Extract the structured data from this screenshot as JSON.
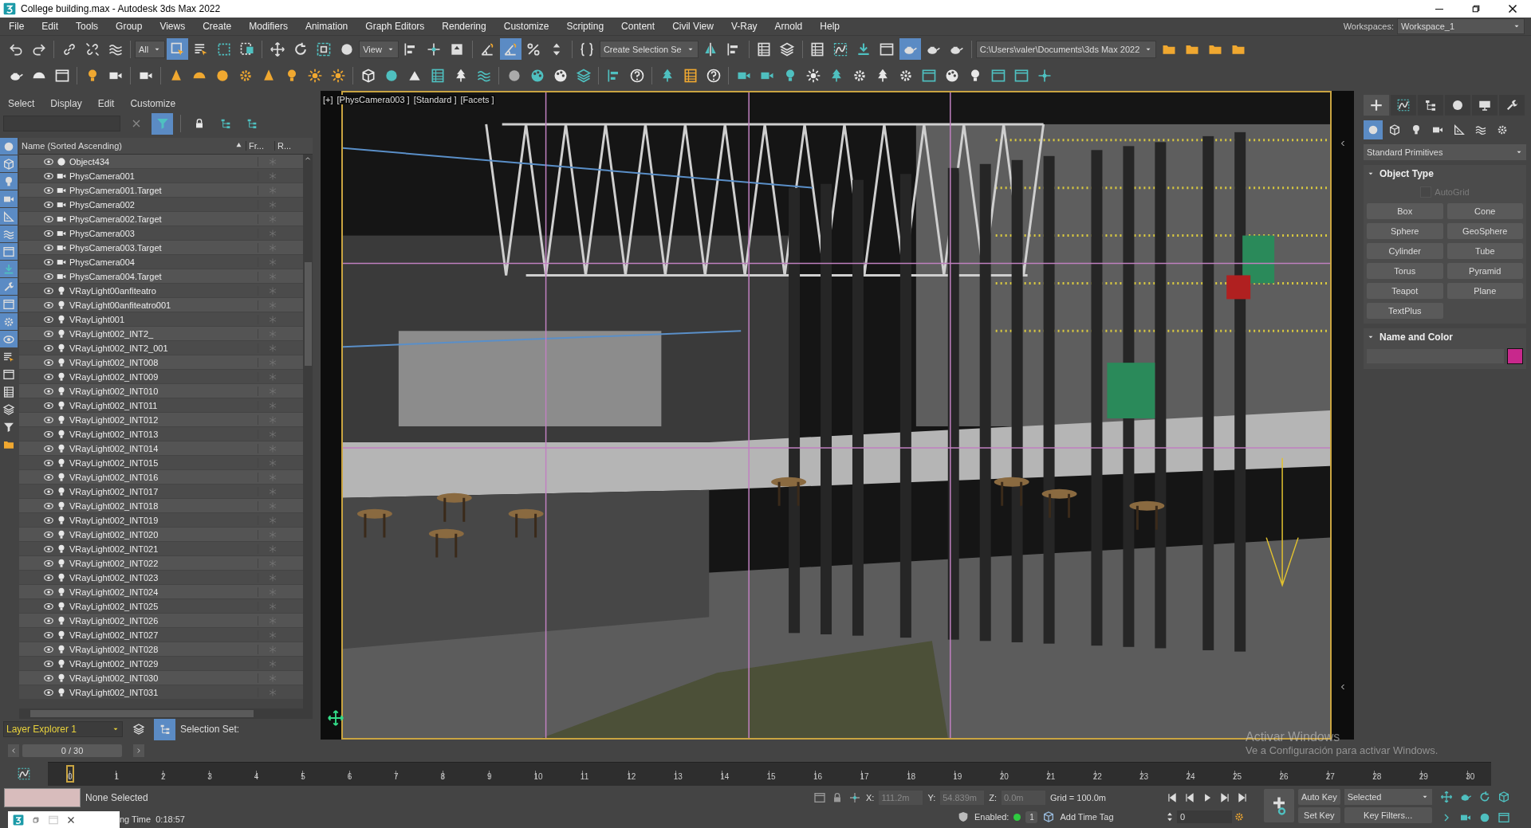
{
  "window": {
    "title": "College building.max - Autodesk 3ds Max 2022"
  },
  "menu_bar": {
    "items": [
      "File",
      "Edit",
      "Tools",
      "Group",
      "Views",
      "Create",
      "Modifiers",
      "Animation",
      "Graph Editors",
      "Rendering",
      "Customize",
      "Scripting",
      "Content",
      "Civil View",
      "V-Ray",
      "Arnold",
      "Help"
    ],
    "workspace_label": "Workspaces:",
    "workspace": "Workspace_1"
  },
  "toolbar_1": [
    {
      "kind": "button",
      "pressed": false
    },
    {
      "kind": "button",
      "pressed": false
    },
    {
      "kind": "sep"
    },
    {
      "kind": "button",
      "pressed": false
    },
    {
      "kind": "button",
      "pressed": false
    },
    {
      "kind": "button",
      "pressed": false
    },
    {
      "kind": "sep"
    },
    {
      "kind": "dropdown",
      "value": "All"
    },
    {
      "kind": "button",
      "pressed": true
    },
    {
      "kind": "button",
      "pressed": false
    },
    {
      "kind": "button",
      "pressed": false
    },
    {
      "kind": "button",
      "pressed": false
    },
    {
      "kind": "sep"
    },
    {
      "kind": "button",
      "pressed": false
    },
    {
      "kind": "button",
      "pressed": false
    },
    {
      "kind": "button",
      "pressed": false
    },
    {
      "kind": "button",
      "pressed": false
    },
    {
      "kind": "dropdown",
      "value": "View"
    },
    {
      "kind": "button",
      "pressed": false
    },
    {
      "kind": "button",
      "pressed": false
    },
    {
      "kind": "button",
      "pressed": false
    },
    {
      "kind": "sep"
    },
    {
      "kind": "button",
      "pressed": false
    },
    {
      "kind": "button",
      "pressed": true
    },
    {
      "kind": "button",
      "pressed": false
    },
    {
      "kind": "button",
      "pressed": false
    },
    {
      "kind": "sep"
    },
    {
      "kind": "button",
      "pressed": false
    },
    {
      "kind": "dropdown",
      "value": "Create Selection Se"
    },
    {
      "kind": "button",
      "pressed": false
    },
    {
      "kind": "button",
      "pressed": false
    },
    {
      "kind": "sep"
    },
    {
      "kind": "button",
      "pressed": false
    },
    {
      "kind": "button",
      "pressed": false
    },
    {
      "kind": "sep"
    },
    {
      "kind": "button",
      "pressed": false
    },
    {
      "kind": "button",
      "pressed": false
    },
    {
      "kind": "button",
      "pressed": false
    },
    {
      "kind": "button",
      "pressed": false
    },
    {
      "kind": "button",
      "pressed": true
    },
    {
      "kind": "button",
      "pressed": false
    },
    {
      "kind": "button",
      "pressed": false
    },
    {
      "kind": "sep"
    },
    {
      "kind": "dropdown",
      "value": "C:\\Users\\valer\\Documents\\3ds Max 2022"
    },
    {
      "kind": "button",
      "pressed": false
    },
    {
      "kind": "button",
      "pressed": false
    },
    {
      "kind": "button",
      "pressed": false
    },
    {
      "kind": "button",
      "pressed": false
    }
  ],
  "toolbar_2": [
    {
      "kind": "button",
      "pressed": false
    },
    {
      "kind": "button",
      "pressed": false
    },
    {
      "kind": "button",
      "pressed": false
    },
    {
      "kind": "sep"
    },
    {
      "kind": "button",
      "pressed": false
    },
    {
      "kind": "button",
      "pressed": false
    },
    {
      "kind": "sep"
    },
    {
      "kind": "button",
      "pressed": false
    },
    {
      "kind": "sep"
    },
    {
      "kind": "button",
      "pressed": false
    },
    {
      "kind": "button",
      "pressed": false
    },
    {
      "kind": "button",
      "pressed": false
    },
    {
      "kind": "button",
      "pressed": false
    },
    {
      "kind": "button",
      "pressed": false
    },
    {
      "kind": "button",
      "pressed": false
    },
    {
      "kind": "button",
      "pressed": false
    },
    {
      "kind": "button",
      "pressed": false
    },
    {
      "kind": "sep"
    },
    {
      "kind": "button",
      "pressed": false
    },
    {
      "kind": "button",
      "pressed": false
    },
    {
      "kind": "button",
      "pressed": false
    },
    {
      "kind": "button",
      "pressed": false
    },
    {
      "kind": "button",
      "pressed": false
    },
    {
      "kind": "button",
      "pressed": false
    },
    {
      "kind": "sep"
    },
    {
      "kind": "button",
      "pressed": false
    },
    {
      "kind": "button",
      "pressed": false
    },
    {
      "kind": "button",
      "pressed": false
    },
    {
      "kind": "button",
      "pressed": false
    },
    {
      "kind": "sep"
    },
    {
      "kind": "button",
      "pressed": false
    },
    {
      "kind": "button",
      "pressed": false
    },
    {
      "kind": "sep"
    },
    {
      "kind": "button",
      "pressed": false
    },
    {
      "kind": "button",
      "pressed": false
    },
    {
      "kind": "button",
      "pressed": false
    },
    {
      "kind": "sep"
    },
    {
      "kind": "button",
      "pressed": false
    },
    {
      "kind": "button",
      "pressed": false
    },
    {
      "kind": "button",
      "pressed": false
    },
    {
      "kind": "button",
      "pressed": false
    },
    {
      "kind": "button",
      "pressed": false
    },
    {
      "kind": "button",
      "pressed": false
    },
    {
      "kind": "button",
      "pressed": false
    },
    {
      "kind": "button",
      "pressed": false
    },
    {
      "kind": "button",
      "pressed": false
    },
    {
      "kind": "button",
      "pressed": false
    },
    {
      "kind": "button",
      "pressed": false
    },
    {
      "kind": "button",
      "pressed": false
    },
    {
      "kind": "button",
      "pressed": false
    },
    {
      "kind": "button",
      "pressed": false
    }
  ],
  "scene_explorer": {
    "menu": [
      "Select",
      "Display",
      "Edit",
      "Customize"
    ],
    "filter_button": {
      "pressed": true
    },
    "side_buttons": [
      {
        "pressed": true
      },
      {
        "pressed": true
      },
      {
        "pressed": true
      },
      {
        "pressed": true
      },
      {
        "pressed": true
      },
      {
        "pressed": true
      },
      {
        "pressed": true
      },
      {
        "pressed": true
      },
      {
        "pressed": true
      },
      {
        "pressed": true
      },
      {
        "pressed": true
      },
      {
        "pressed": true
      },
      {
        "pressed": false
      },
      {
        "pressed": false
      },
      {
        "pressed": false
      },
      {
        "pressed": false
      },
      {
        "pressed": false
      },
      {
        "pressed": false
      }
    ],
    "columns": [
      "Name (Sorted Ascending)",
      "Fr...",
      "R..."
    ],
    "rows": [
      {
        "name": "Object434",
        "kind": "object"
      },
      {
        "name": "PhysCamera001",
        "kind": "camera"
      },
      {
        "name": "PhysCamera001.Target",
        "kind": "camera"
      },
      {
        "name": "PhysCamera002",
        "kind": "camera"
      },
      {
        "name": "PhysCamera002.Target",
        "kind": "camera"
      },
      {
        "name": "PhysCamera003",
        "kind": "camera"
      },
      {
        "name": "PhysCamera003.Target",
        "kind": "camera"
      },
      {
        "name": "PhysCamera004",
        "kind": "camera"
      },
      {
        "name": "PhysCamera004.Target",
        "kind": "camera"
      },
      {
        "name": "VRayLight00anfiteatro",
        "kind": "light"
      },
      {
        "name": "VRayLight00anfiteatro001",
        "kind": "light"
      },
      {
        "name": "VRayLight001",
        "kind": "light"
      },
      {
        "name": "VRayLight002_INT2_",
        "kind": "light"
      },
      {
        "name": "VRayLight002_INT2_001",
        "kind": "light"
      },
      {
        "name": "VRayLight002_INT008",
        "kind": "light"
      },
      {
        "name": "VRayLight002_INT009",
        "kind": "light"
      },
      {
        "name": "VRayLight002_INT010",
        "kind": "light"
      },
      {
        "name": "VRayLight002_INT011",
        "kind": "light"
      },
      {
        "name": "VRayLight002_INT012",
        "kind": "light"
      },
      {
        "name": "VRayLight002_INT013",
        "kind": "light"
      },
      {
        "name": "VRayLight002_INT014",
        "kind": "light"
      },
      {
        "name": "VRayLight002_INT015",
        "kind": "light"
      },
      {
        "name": "VRayLight002_INT016",
        "kind": "light"
      },
      {
        "name": "VRayLight002_INT017",
        "kind": "light"
      },
      {
        "name": "VRayLight002_INT018",
        "kind": "light"
      },
      {
        "name": "VRayLight002_INT019",
        "kind": "light"
      },
      {
        "name": "VRayLight002_INT020",
        "kind": "light"
      },
      {
        "name": "VRayLight002_INT021",
        "kind": "light"
      },
      {
        "name": "VRayLight002_INT022",
        "kind": "light"
      },
      {
        "name": "VRayLight002_INT023",
        "kind": "light"
      },
      {
        "name": "VRayLight002_INT024",
        "kind": "light"
      },
      {
        "name": "VRayLight002_INT025",
        "kind": "light"
      },
      {
        "name": "VRayLight002_INT026",
        "kind": "light"
      },
      {
        "name": "VRayLight002_INT027",
        "kind": "light"
      },
      {
        "name": "VRayLight002_INT028",
        "kind": "light"
      },
      {
        "name": "VRayLight002_INT029",
        "kind": "light"
      },
      {
        "name": "VRayLight002_INT030",
        "kind": "light"
      },
      {
        "name": "VRayLight002_INT031",
        "kind": "light"
      }
    ],
    "layer_dropdown": "Layer Explorer 1",
    "layer_buttons": [
      {
        "pressed": false
      },
      {
        "pressed": true
      }
    ],
    "selection_set_label": "Selection Set:"
  },
  "time_slider": {
    "label": "0 / 30",
    "level": 0
  },
  "viewport": {
    "labels": [
      "[+]",
      "[PhysCamera003 ]",
      "[Standard ]",
      "[Facets ]"
    ]
  },
  "command_panel": {
    "tabs": [
      {
        "selected": true
      },
      {
        "selected": false
      },
      {
        "selected": false
      },
      {
        "selected": false
      },
      {
        "selected": false
      },
      {
        "selected": false
      }
    ],
    "categories": [
      {
        "selected": true
      },
      {
        "selected": false
      },
      {
        "selected": false
      },
      {
        "selected": false
      },
      {
        "selected": false
      },
      {
        "selected": false
      },
      {
        "selected": false
      }
    ],
    "category_dropdown": "Standard Primitives",
    "rollouts": [
      {
        "kind": "object_type",
        "title": "Object Type",
        "expanded": true,
        "autogrid": {
          "label": "AutoGrid",
          "checked": false,
          "disabled": true
        },
        "buttons": [
          "Box",
          "Cone",
          "Sphere",
          "GeoSphere",
          "Cylinder",
          "Tube",
          "Torus",
          "Pyramid",
          "Teapot",
          "Plane",
          "TextPlus"
        ]
      },
      {
        "kind": "name_color",
        "title": "Name and Color",
        "expanded": true,
        "color": "#c8288c"
      }
    ]
  },
  "timeline": {
    "ticks": [
      "0",
      "1",
      "2",
      "3",
      "4",
      "5",
      "6",
      "7",
      "8",
      "9",
      "10",
      "11",
      "12",
      "13",
      "14",
      "15",
      "16",
      "17",
      "18",
      "19",
      "20",
      "21",
      "22",
      "23",
      "24",
      "25",
      "26",
      "27",
      "28",
      "29",
      "30"
    ]
  },
  "status_bar": {
    "selection": "None Selected",
    "render_time": "ng Time  0:18:57",
    "x_label": "X:",
    "x": "111.2m",
    "y_label": "Y:",
    "y": "54.839m",
    "z_label": "Z:",
    "z": "0.0m",
    "grid": "Grid = 100.0m",
    "enabled_label": "Enabled:",
    "enabled_count": "1",
    "time_tag": "Add Time Tag",
    "frame": "0",
    "auto_key": "Auto Key",
    "key_mode": "Selected",
    "set_key": "Set Key",
    "key_filters": "Key Filters..."
  },
  "os_overlay": {
    "title": "Activar Windows",
    "message": "Ve a Configuración para activar Windows."
  }
}
